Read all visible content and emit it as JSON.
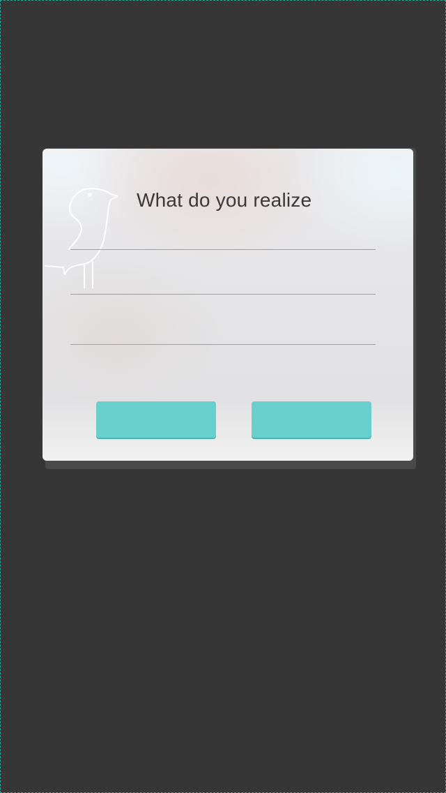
{
  "dialog": {
    "title": "What do you realize",
    "fields": [
      {
        "value": "",
        "placeholder": ""
      },
      {
        "value": "",
        "placeholder": ""
      },
      {
        "value": "",
        "placeholder": ""
      }
    ],
    "buttons": {
      "left_label": "",
      "right_label": ""
    },
    "decoration_icon": "bird-icon"
  },
  "colors": {
    "background": "#363636",
    "accent": "#69cfcd",
    "underline": "#45c7bf",
    "title_text": "#3a3838"
  }
}
